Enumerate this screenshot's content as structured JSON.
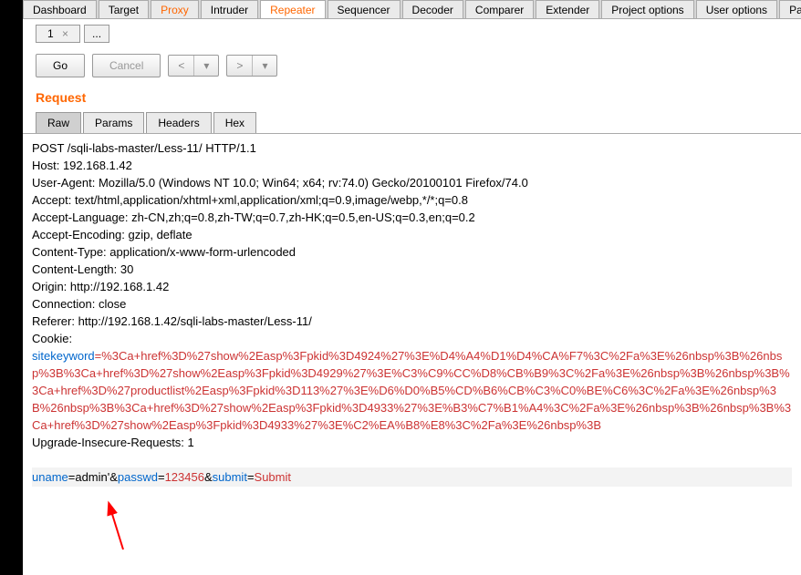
{
  "topTabs": {
    "t0": "Dashboard",
    "t1": "Target",
    "t2": "Proxy",
    "t3": "Intruder",
    "t4": "Repeater",
    "t5": "Sequencer",
    "t6": "Decoder",
    "t7": "Comparer",
    "t8": "Extender",
    "t9": "Project options",
    "t10": "User options",
    "t11": "Passi"
  },
  "subTab": {
    "label": "1",
    "close": "×",
    "more": "..."
  },
  "toolbar": {
    "go": "Go",
    "cancel": "Cancel",
    "prev": "<",
    "next": ">",
    "drop": "▾"
  },
  "section": {
    "title": "Request"
  },
  "viewTabs": {
    "raw": "Raw",
    "params": "Params",
    "headers": "Headers",
    "hex": "Hex"
  },
  "req": {
    "line1": "POST /sqli-labs-master/Less-11/ HTTP/1.1",
    "host": "Host: 192.168.1.42",
    "ua": "User-Agent: Mozilla/5.0 (Windows NT 10.0; Win64; x64; rv:74.0) Gecko/20100101 Firefox/74.0",
    "accept": "Accept: text/html,application/xhtml+xml,application/xml;q=0.9,image/webp,*/*;q=0.8",
    "acceptlang": "Accept-Language: zh-CN,zh;q=0.8,zh-TW;q=0.7,zh-HK;q=0.5,en-US;q=0.3,en;q=0.2",
    "acceptenc": "Accept-Encoding: gzip, deflate",
    "ctype": "Content-Type: application/x-www-form-urlencoded",
    "clen": "Content-Length: 30",
    "origin": "Origin: http://192.168.1.42",
    "conn": "Connection: close",
    "referer": "Referer: http://192.168.1.42/sqli-labs-master/Less-11/",
    "cookieLabel": "Cookie:",
    "cookieKey": "sitekeyword",
    "eq": "=",
    "cookieVal": "%3Ca+href%3D%27show%2Easp%3Fpkid%3D4924%27%3E%D4%A4%D1%D4%CA%F7%3C%2Fa%3E%26nbsp%3B%26nbsp%3B%3Ca+href%3D%27show%2Easp%3Fpkid%3D4929%27%3E%C3%C9%CC%D8%CB%B9%3C%2Fa%3E%26nbsp%3B%26nbsp%3B%3Ca+href%3D%27productlist%2Easp%3Fpkid%3D113%27%3E%D6%D0%B5%CD%B6%CB%C3%C0%BE%C6%3C%2Fa%3E%26nbsp%3B%26nbsp%3B%3Ca+href%3D%27show%2Easp%3Fpkid%3D4933%27%3E%B3%C7%B1%A4%3C%2Fa%3E%26nbsp%3B%26nbsp%3B%3Ca+href%3D%27show%2Easp%3Fpkid%3D4933%27%3E%C2%EA%B8%E8%3C%2Fa%3E%26nbsp%3B",
    "upgrade": "Upgrade-Insecure-Requests: 1",
    "body": {
      "p1k": "uname",
      "p1v": "admin'",
      "amp": "&",
      "p2k": "passwd",
      "p2v": "123456",
      "p3k": "submit",
      "p3v": "Submit"
    }
  }
}
